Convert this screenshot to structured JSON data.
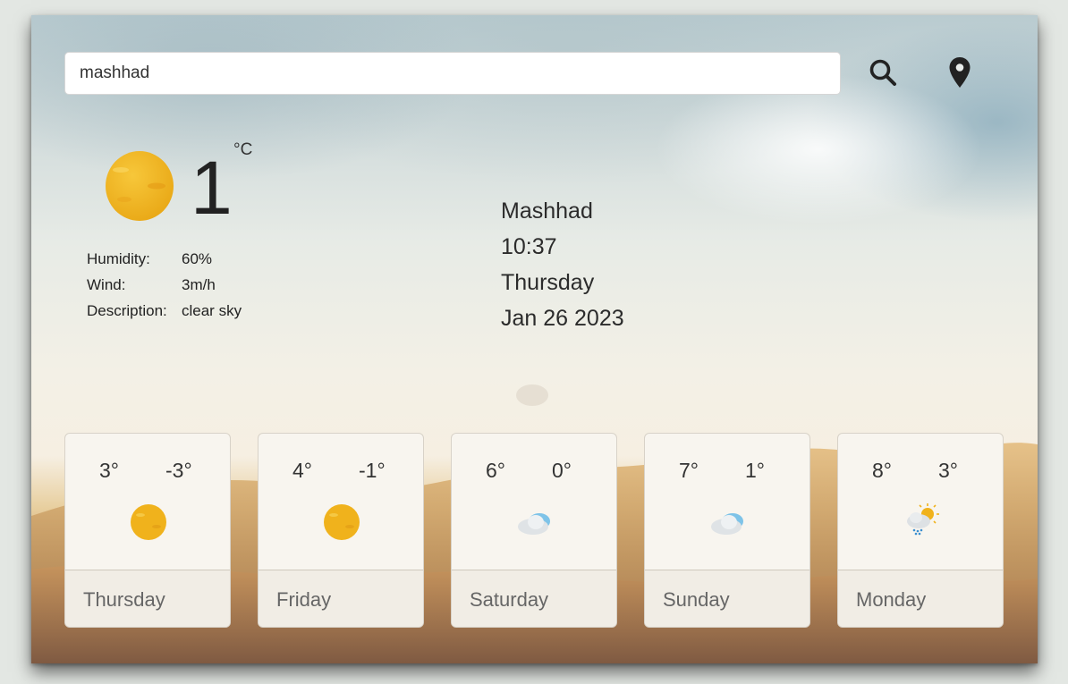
{
  "search": {
    "value": "mashhad",
    "search_icon": "magnifier-icon",
    "location_icon": "map-pin-icon"
  },
  "current": {
    "icon": "sun-icon",
    "temperature": "1",
    "unit": "°C",
    "details": [
      {
        "label": "Humidity:",
        "value": "60%"
      },
      {
        "label": "Wind:",
        "value": "3m/h"
      },
      {
        "label": "Description:",
        "value": "clear sky"
      }
    ]
  },
  "location": {
    "city": "Mashhad",
    "time": "10:37",
    "weekday": "Thursday",
    "date": "Jan 26 2023"
  },
  "forecast": [
    {
      "high": "3°",
      "low": "-3°",
      "icon": "sun-icon",
      "day": "Thursday"
    },
    {
      "high": "4°",
      "low": "-1°",
      "icon": "sun-icon",
      "day": "Friday"
    },
    {
      "high": "6°",
      "low": "0°",
      "icon": "cloud-icon",
      "day": "Saturday"
    },
    {
      "high": "7°",
      "low": "1°",
      "icon": "cloud-icon",
      "day": "Sunday"
    },
    {
      "high": "8°",
      "low": "3°",
      "icon": "sun-cloud-rain-icon",
      "day": "Monday"
    }
  ],
  "colors": {
    "sun": "#f2b51d",
    "cloud": "#dfe3e6",
    "cloud_blue": "#7ec3e8",
    "card_bg": "#f8f5ef"
  }
}
